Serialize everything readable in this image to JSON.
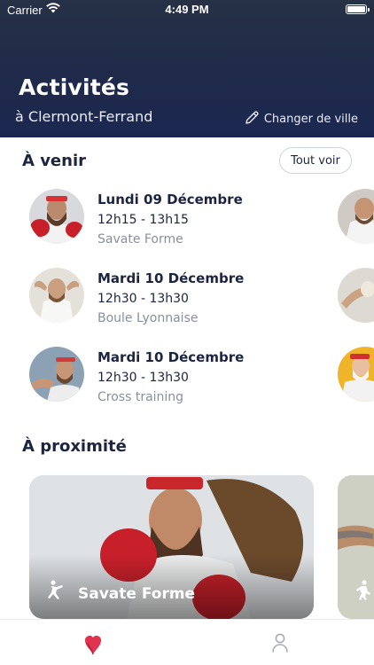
{
  "status_bar": {
    "carrier": "Carrier",
    "time": "4:49 PM"
  },
  "header": {
    "title": "Activités",
    "city": "à Clermont-Ferrand",
    "change_city": "Changer de ville",
    "gradient_colors": [
      "#263146",
      "#1c2750"
    ]
  },
  "upcoming": {
    "title": "À venir",
    "see_all": "Tout voir",
    "events": [
      {
        "date": "Lundi 09 Décembre",
        "time": "12h15 - 13h15",
        "activity": "Savate Forme"
      },
      {
        "date": "Mardi 10 Décembre",
        "time": "12h30 - 13h30",
        "activity": "Boule Lyonnaise"
      },
      {
        "date": "Mardi 10 Décembre",
        "time": "12h30 - 13h30",
        "activity": "Cross training"
      }
    ]
  },
  "nearby": {
    "title": "À proximité",
    "cards": [
      {
        "name": "Savate Forme",
        "icon": "boxing-person-icon"
      }
    ]
  },
  "tabbar": {
    "items": [
      {
        "icon": "heart-location-icon",
        "active": true,
        "color": "#e0334f"
      },
      {
        "icon": "profile-icon",
        "active": false
      }
    ]
  }
}
